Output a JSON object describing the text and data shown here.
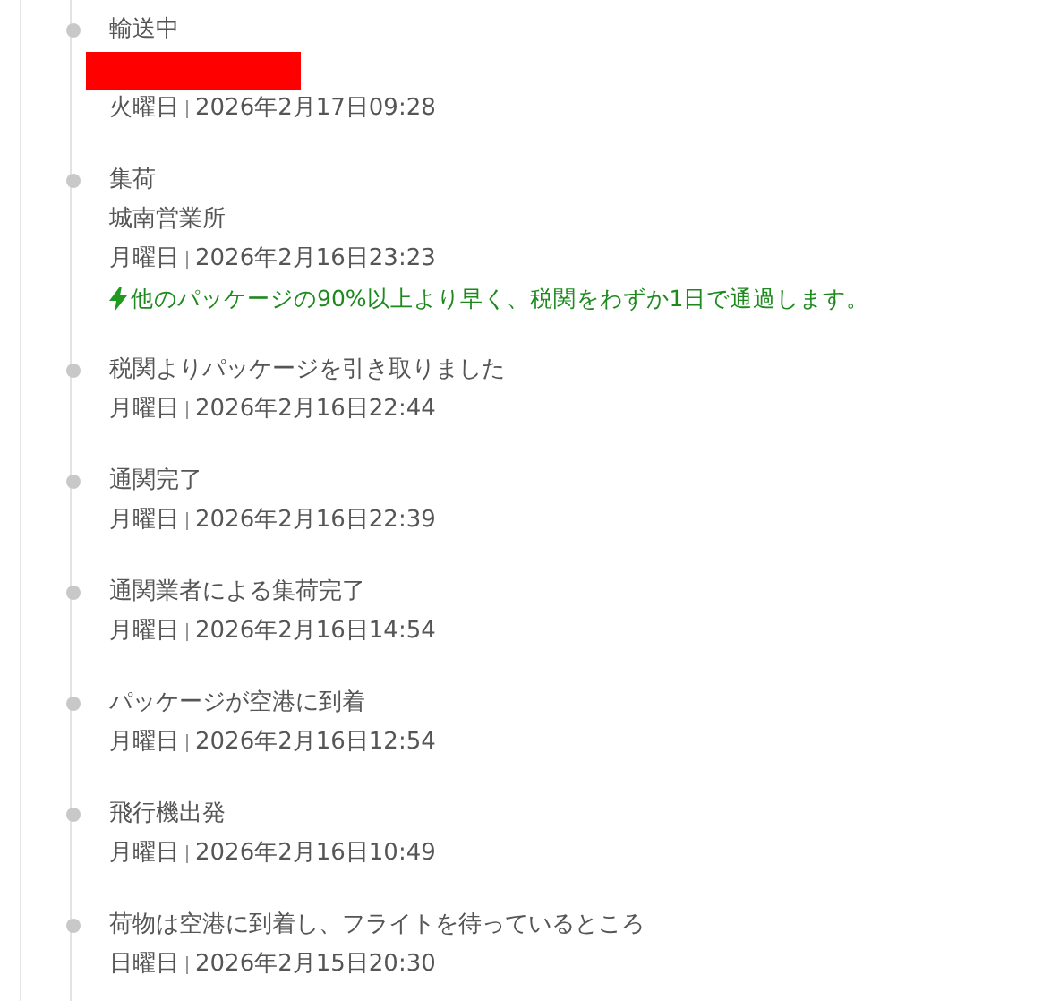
{
  "events": [
    {
      "title": "輸送中",
      "redacted": true,
      "day": "火曜日",
      "time": "2026年2月17日09:28"
    },
    {
      "title": "集荷",
      "location": "城南営業所",
      "day": "月曜日",
      "time": "2026年2月16日23:23",
      "note": "他のパッケージの90%以上より早く、税関をわずか1日で通過します。"
    },
    {
      "title": "税関よりパッケージを引き取りました",
      "day": "月曜日",
      "time": "2026年2月16日22:44"
    },
    {
      "title": "通関完了",
      "day": "月曜日",
      "time": "2026年2月16日22:39"
    },
    {
      "title": "通関業者による集荷完了",
      "day": "月曜日",
      "time": "2026年2月16日14:54"
    },
    {
      "title": "パッケージが空港に到着",
      "day": "月曜日",
      "time": "2026年2月16日12:54"
    },
    {
      "title": "飛行機出発",
      "day": "月曜日",
      "time": "2026年2月16日10:49"
    },
    {
      "title": "荷物は空港に到着し、フライトを待っているところ",
      "day": "日曜日",
      "time": "2026年2月15日20:30"
    }
  ]
}
